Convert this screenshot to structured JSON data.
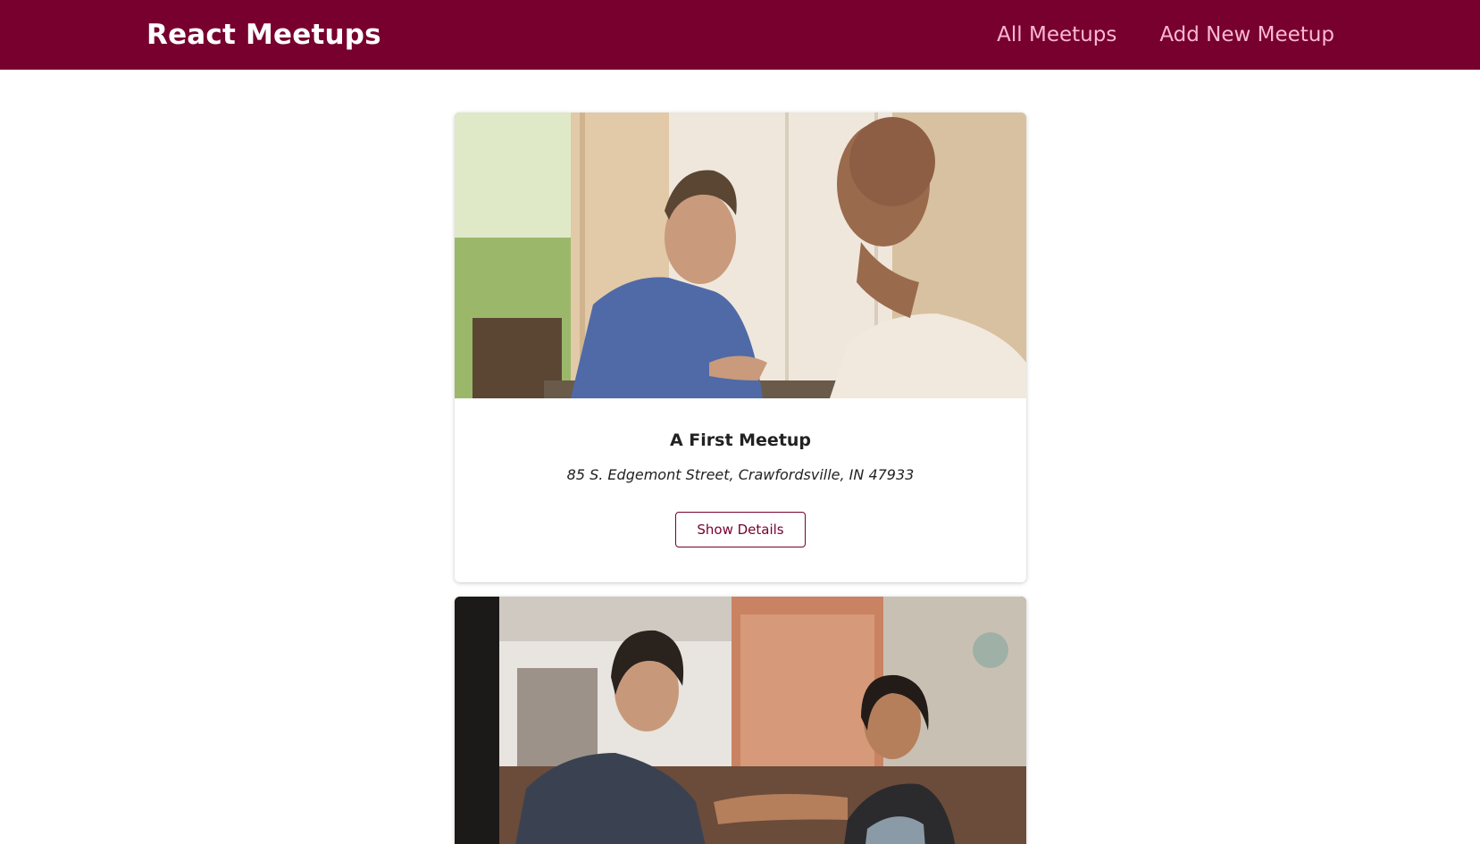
{
  "header": {
    "logo": "React Meetups",
    "nav": [
      {
        "label": "All Meetups"
      },
      {
        "label": "Add New Meetup"
      }
    ]
  },
  "meetups": [
    {
      "title": "A First Meetup",
      "address": "85 S. Edgemont Street, Crawfordsville, IN 47933",
      "button_label": "Show Details",
      "image": "photo-two-men-talking"
    },
    {
      "image": "photo-man-and-woman-cafe"
    }
  ],
  "colors": {
    "header_bg": "#77002e",
    "nav_link": "#fcb8d2",
    "accent": "#77002e"
  }
}
